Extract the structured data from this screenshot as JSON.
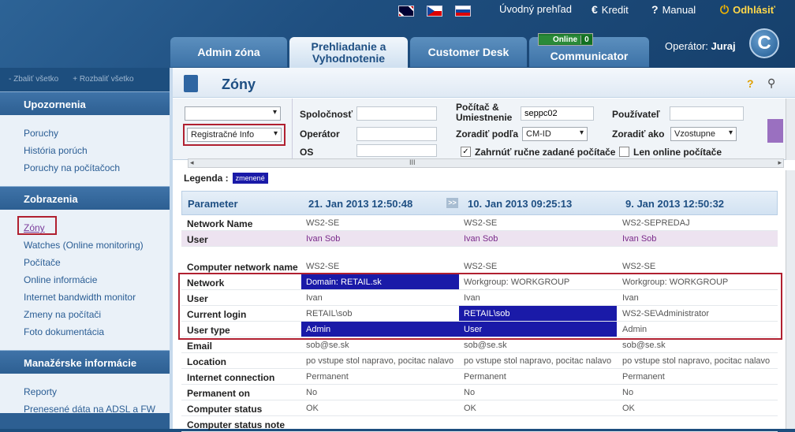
{
  "header": {
    "flags": [
      "sk-en",
      "cz",
      "sk"
    ],
    "links": [
      {
        "name": "Úvodný prehľad",
        "icon": ""
      },
      {
        "name": "Kredit",
        "icon": "€"
      },
      {
        "name": "Manual",
        "icon": "?"
      },
      {
        "name": "Odhlásiť",
        "icon": "⏻"
      }
    ],
    "tabs": [
      "Admin zóna",
      "Prehliadanie a Vyhodnotenie",
      "Customer Desk",
      "Communicator"
    ],
    "online_label": "Online",
    "online_count": "0",
    "operator_label": "Operátor:",
    "operator_name": "Juraj",
    "logo": "C"
  },
  "sidebar": {
    "collapse_all": "- Zbaliť všetko",
    "expand_all": "+ Rozbaliť všetko",
    "sections": [
      {
        "title": "Upozornenia",
        "items": [
          "Poruchy",
          "História porúch",
          "Poruchy na počítačoch"
        ]
      },
      {
        "title": "Zobrazenia",
        "items": [
          "Zóny",
          "Watches (Online monitoring)",
          "Počítače",
          "Online informácie",
          "Internet bandwidth monitor",
          "Zmeny na počítači",
          "Foto dokumentácia"
        ]
      },
      {
        "title": "Manažérske informácie",
        "items": [
          "Reporty",
          "Prenesené dáta na ADSL a FW"
        ]
      }
    ]
  },
  "page": {
    "title": "Zóny",
    "help_icon": "?",
    "search_icon": "⚲"
  },
  "filters": {
    "select1": "",
    "select2": "Registračné Info",
    "spolocnost": "Spoločnosť",
    "operator": "Operátor",
    "os": "OS",
    "pocitac": "Počítač & Umiestnenie",
    "pocitac_value": "seppc02",
    "zoradit_podla": "Zoradiť podľa",
    "zoradit_podla_value": "CM-ID",
    "pouzivatel": "Používateľ",
    "zoradit_ako": "Zoradiť ako",
    "zoradit_ako_value": "Vzostupne",
    "zahrnut": "Zahrnúť ručne zadané počítače",
    "len_online": "Len online počítače"
  },
  "legend": {
    "label": "Legenda :",
    "badge": "zmenené"
  },
  "table": {
    "headers": [
      "Parameter",
      "21. Jan 2013 12:50:48",
      "10. Jan 2013 09:25:13",
      "9. Jan 2013 12:50:32"
    ],
    "skip_icon": ">>",
    "rows": [
      {
        "p": "Network Name",
        "v": [
          "WS2-SE",
          "WS2-SE",
          "WS2-SEPREDAJ"
        ]
      },
      {
        "p": "User",
        "v": [
          "Ivan Sob",
          "Ivan Sob",
          "Ivan Sob"
        ]
      },
      {
        "p": "",
        "v": [
          "",
          "",
          ""
        ]
      },
      {
        "p": "Computer network name",
        "v": [
          "WS2-SE",
          "WS2-SE",
          "WS2-SE"
        ]
      },
      {
        "p": "Network",
        "v": [
          "Domain: RETAIL.sk",
          "Workgroup: WORKGROUP",
          "Workgroup: WORKGROUP"
        ]
      },
      {
        "p": "User",
        "v": [
          "Ivan",
          "Ivan",
          "Ivan"
        ]
      },
      {
        "p": "Current login",
        "v": [
          "RETAIL\\sob",
          "RETAIL\\sob",
          "WS2-SE\\Administrator"
        ]
      },
      {
        "p": "User type",
        "v": [
          "Admin",
          "User",
          "Admin"
        ]
      },
      {
        "p": "Email",
        "v": [
          "sob@se.sk",
          "sob@se.sk",
          "sob@se.sk"
        ]
      },
      {
        "p": "Location",
        "v": [
          "po vstupe stol napravo, pocitac nalavo",
          "po vstupe stol napravo, pocitac nalavo",
          "po vstupe stol napravo, pocitac nalavo"
        ]
      },
      {
        "p": "Internet connection",
        "v": [
          "Permanent",
          "Permanent",
          "Permanent"
        ]
      },
      {
        "p": "Permanent on",
        "v": [
          "No",
          "No",
          "No"
        ]
      },
      {
        "p": "Computer status",
        "v": [
          "OK",
          "OK",
          "OK"
        ]
      },
      {
        "p": "Computer status note",
        "v": [
          "",
          "",
          ""
        ]
      }
    ]
  }
}
